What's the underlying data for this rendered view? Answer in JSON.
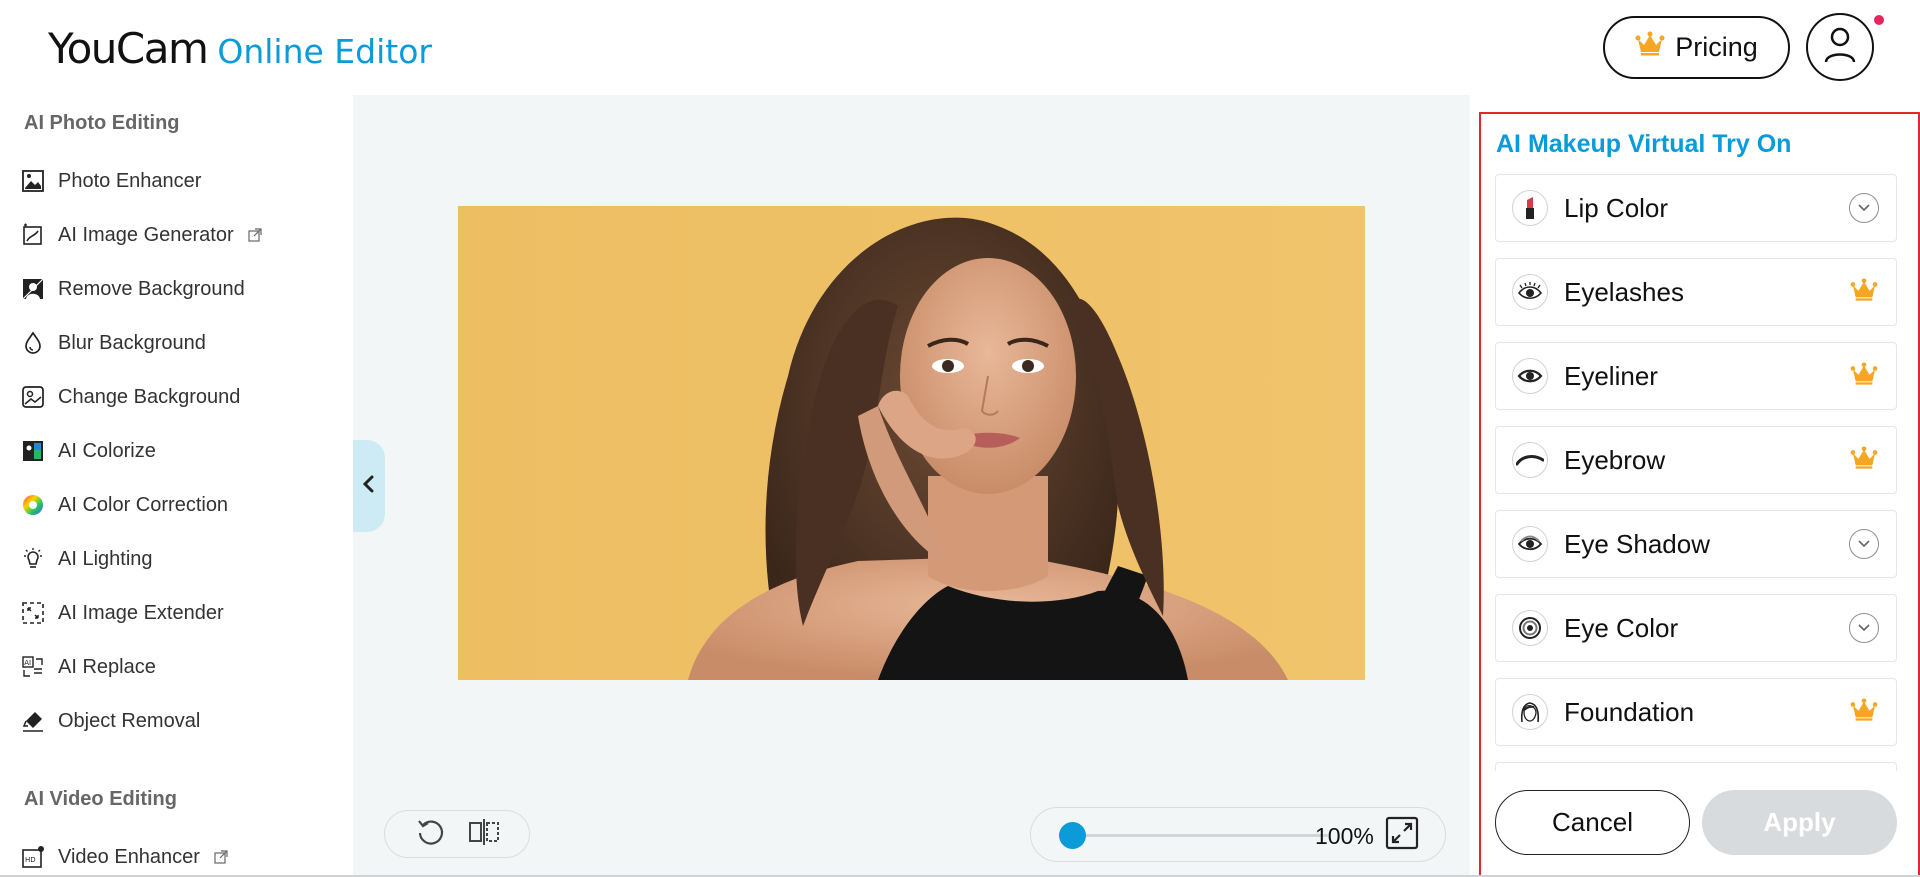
{
  "header": {
    "logo_main": "YouCam",
    "logo_sub": "Online Editor",
    "pricing_label": "Pricing",
    "colors": {
      "brand": "#0a9bd8",
      "crown": "#f5a623",
      "notification": "#e8245c"
    }
  },
  "sidebar": {
    "photo_section_title": "AI Photo Editing",
    "photo_items": [
      {
        "label": "Photo Enhancer",
        "icon": "photo-enhancer-icon",
        "external": false
      },
      {
        "label": "AI Image Generator",
        "icon": "ai-image-generator-icon",
        "external": true
      },
      {
        "label": "Remove Background",
        "icon": "remove-background-icon",
        "external": false
      },
      {
        "label": "Blur Background",
        "icon": "blur-background-icon",
        "external": false
      },
      {
        "label": "Change Background",
        "icon": "change-background-icon",
        "external": false
      },
      {
        "label": "AI Colorize",
        "icon": "colorize-icon",
        "external": false
      },
      {
        "label": "AI Color Correction",
        "icon": "color-correction-icon",
        "external": false
      },
      {
        "label": "AI Lighting",
        "icon": "lighting-icon",
        "external": false
      },
      {
        "label": "AI Image Extender",
        "icon": "image-extender-icon",
        "external": false
      },
      {
        "label": "AI Replace",
        "icon": "ai-replace-icon",
        "external": false
      },
      {
        "label": "Object Removal",
        "icon": "object-removal-icon",
        "external": false
      }
    ],
    "video_section_title": "AI Video Editing",
    "video_items": [
      {
        "label": "Video Enhancer",
        "icon": "video-enhancer-icon",
        "external": true
      }
    ]
  },
  "canvas": {
    "zoom_label": "100%",
    "zoom_level": 0
  },
  "panel": {
    "title": "AI Makeup Virtual Try On",
    "options": [
      {
        "label": "Lip Color",
        "icon": "lipstick-icon",
        "premium": false
      },
      {
        "label": "Eyelashes",
        "icon": "eyelashes-icon",
        "premium": true
      },
      {
        "label": "Eyeliner",
        "icon": "eyeliner-icon",
        "premium": true
      },
      {
        "label": "Eyebrow",
        "icon": "eyebrow-icon",
        "premium": true
      },
      {
        "label": "Eye Shadow",
        "icon": "eye-shadow-icon",
        "premium": false
      },
      {
        "label": "Eye Color",
        "icon": "eye-color-icon",
        "premium": false
      },
      {
        "label": "Foundation",
        "icon": "foundation-icon",
        "premium": true
      }
    ],
    "cancel_label": "Cancel",
    "apply_label": "Apply"
  }
}
